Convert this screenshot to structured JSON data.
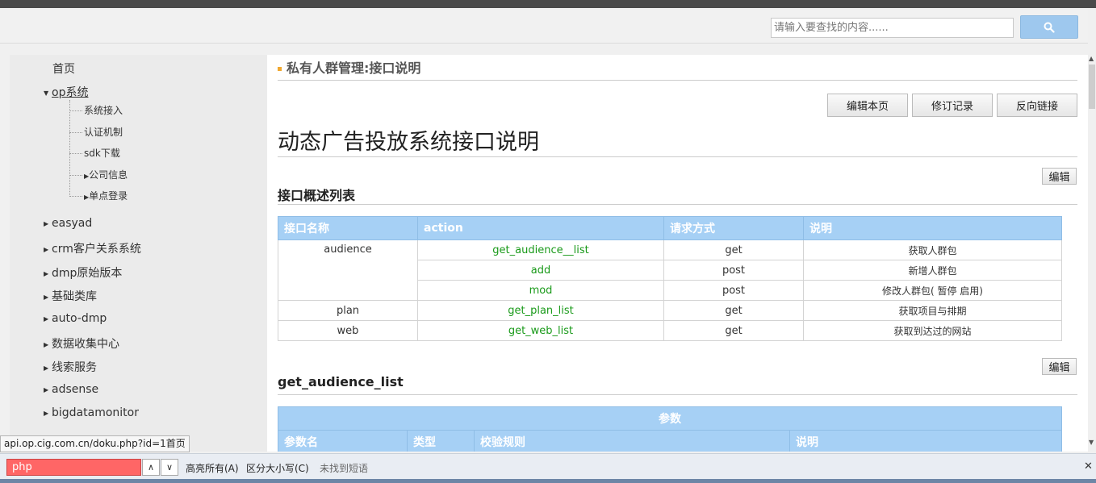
{
  "search": {
    "placeholder": "请输入要查找的内容......"
  },
  "sidebar": {
    "home": "首页",
    "op_system": "op系统",
    "op_children": [
      "系统接入",
      "认证机制",
      "sdk下载",
      "公司信息",
      "单点登录"
    ],
    "items": [
      "easyad",
      "crm客户关系系统",
      "dmp原始版本",
      "基础类库",
      "auto-dmp",
      "数据收集中心",
      "线索服务",
      "adsense",
      "bigdatamonitor"
    ]
  },
  "page": {
    "breadcrumb_title": "私有人群管理:接口说明",
    "buttons": {
      "edit_page": "编辑本页",
      "revisions": "修订记录",
      "backlinks": "反向链接"
    },
    "title": "动态广告投放系统接口说明",
    "edit_label": "编辑",
    "section1_title": "接口概述列表",
    "section2_title": "get_audience_list"
  },
  "api_table": {
    "headers": [
      "接口名称",
      "action",
      "请求方式",
      "说明"
    ],
    "rows": [
      {
        "name": "audience",
        "action": "get_audience__list",
        "method": "get",
        "desc": "获取人群包"
      },
      {
        "name": "",
        "action": "add",
        "method": "post",
        "desc": "新增人群包"
      },
      {
        "name": "",
        "action": "mod",
        "method": "post",
        "desc": "修改人群包( 暂停 启用)"
      },
      {
        "name": "plan",
        "action": "get_plan_list",
        "method": "get",
        "desc": "获取项目与排期"
      },
      {
        "name": "web",
        "action": "get_web_list",
        "method": "get",
        "desc": "获取到达过的网站"
      }
    ]
  },
  "params_table": {
    "caption": "参数",
    "headers": [
      "参数名",
      "类型",
      "校验规则",
      "说明"
    ]
  },
  "status_url": "api.op.cig.com.cn/doku.php?id=1首页",
  "findbar": {
    "query": "php",
    "highlight_all": "高亮所有(A)",
    "match_case": "区分大小写(C)",
    "status": "未找到短语"
  }
}
